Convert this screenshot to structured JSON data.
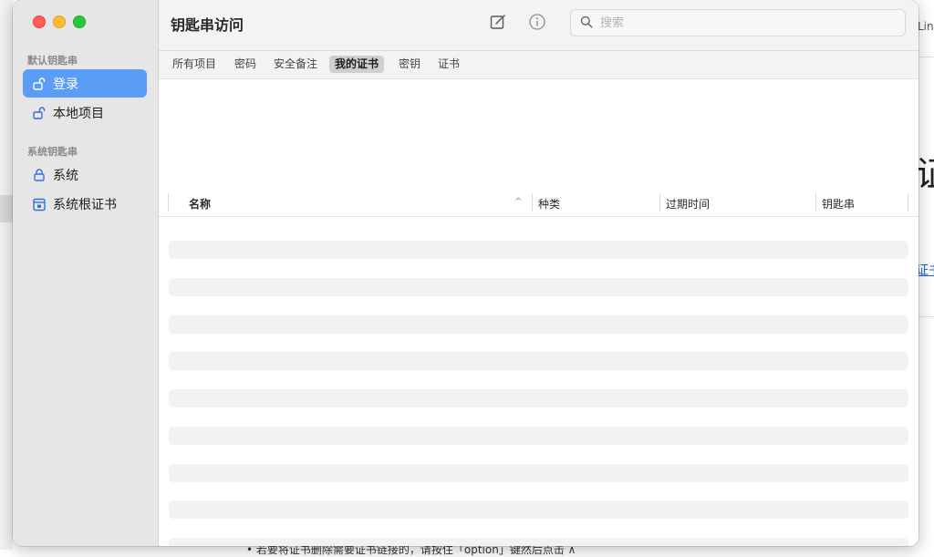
{
  "background": {
    "top_right_text": "Lin",
    "big_text": "证",
    "link_text": "证书",
    "bottom_text": "• 若要将证书删除需要证书链接的，请按住「option」键然后点击 ∧"
  },
  "window": {
    "title": "钥匙串访问",
    "toolbar": {
      "compose_icon": "compose-icon",
      "info_icon": "info-icon",
      "search_placeholder": "搜索"
    },
    "sidebar": {
      "default_section": "默认钥匙串",
      "default_items": [
        {
          "label": "登录",
          "icon": "unlock-icon",
          "selected": true
        },
        {
          "label": "本地项目",
          "icon": "unlock-icon",
          "selected": false
        }
      ],
      "system_section": "系统钥匙串",
      "system_items": [
        {
          "label": "系统",
          "icon": "lock-icon"
        },
        {
          "label": "系统根证书",
          "icon": "locked-cabinet-icon"
        }
      ]
    },
    "tabs": [
      {
        "label": "所有项目",
        "active": false
      },
      {
        "label": "密码",
        "active": false
      },
      {
        "label": "安全备注",
        "active": false
      },
      {
        "label": "我的证书",
        "active": true
      },
      {
        "label": "密钥",
        "active": false
      },
      {
        "label": "证书",
        "active": false
      }
    ],
    "table": {
      "columns": [
        "名称",
        "种类",
        "过期时间",
        "钥匙串"
      ],
      "sort_indicator": "^"
    },
    "colors": {
      "accent": "#5b9cf5",
      "sidebar_bg": "#e6e6e6",
      "traffic_red": "#ff5f57",
      "traffic_yellow": "#febc2e",
      "traffic_green": "#28c840"
    }
  }
}
